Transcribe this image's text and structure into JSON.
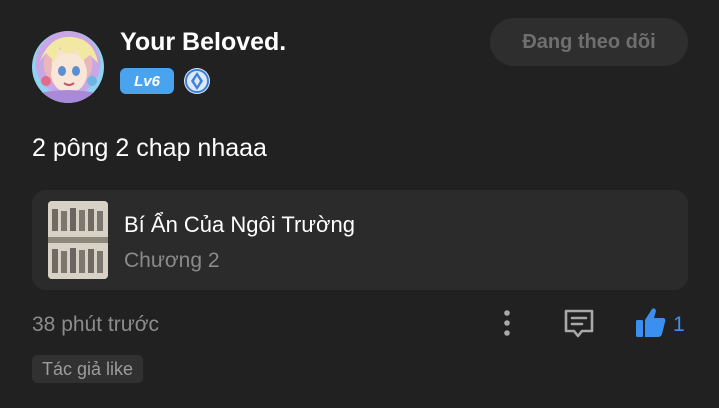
{
  "user": {
    "name": "Your Beloved.",
    "level": "Lv6",
    "rank_icon": "diamond-rank-icon",
    "avatar_icon": "anime-avatar"
  },
  "follow_button": {
    "label": "Đang theo dõi"
  },
  "comment": {
    "text": "2 pông 2 chap nhaaa"
  },
  "chapter": {
    "title": "Bí Ẩn Của Ngôi Trường",
    "number": "Chương 2",
    "thumbnail": "manga-cover-thumbnail"
  },
  "meta": {
    "timestamp": "38 phút trước",
    "like_count": "1",
    "author_like_tag": "Tác giả like"
  },
  "colors": {
    "background": "#212121",
    "accent": "#3b8ff0",
    "level_badge": "#4aa3ef",
    "card": "#2b2b2b"
  }
}
